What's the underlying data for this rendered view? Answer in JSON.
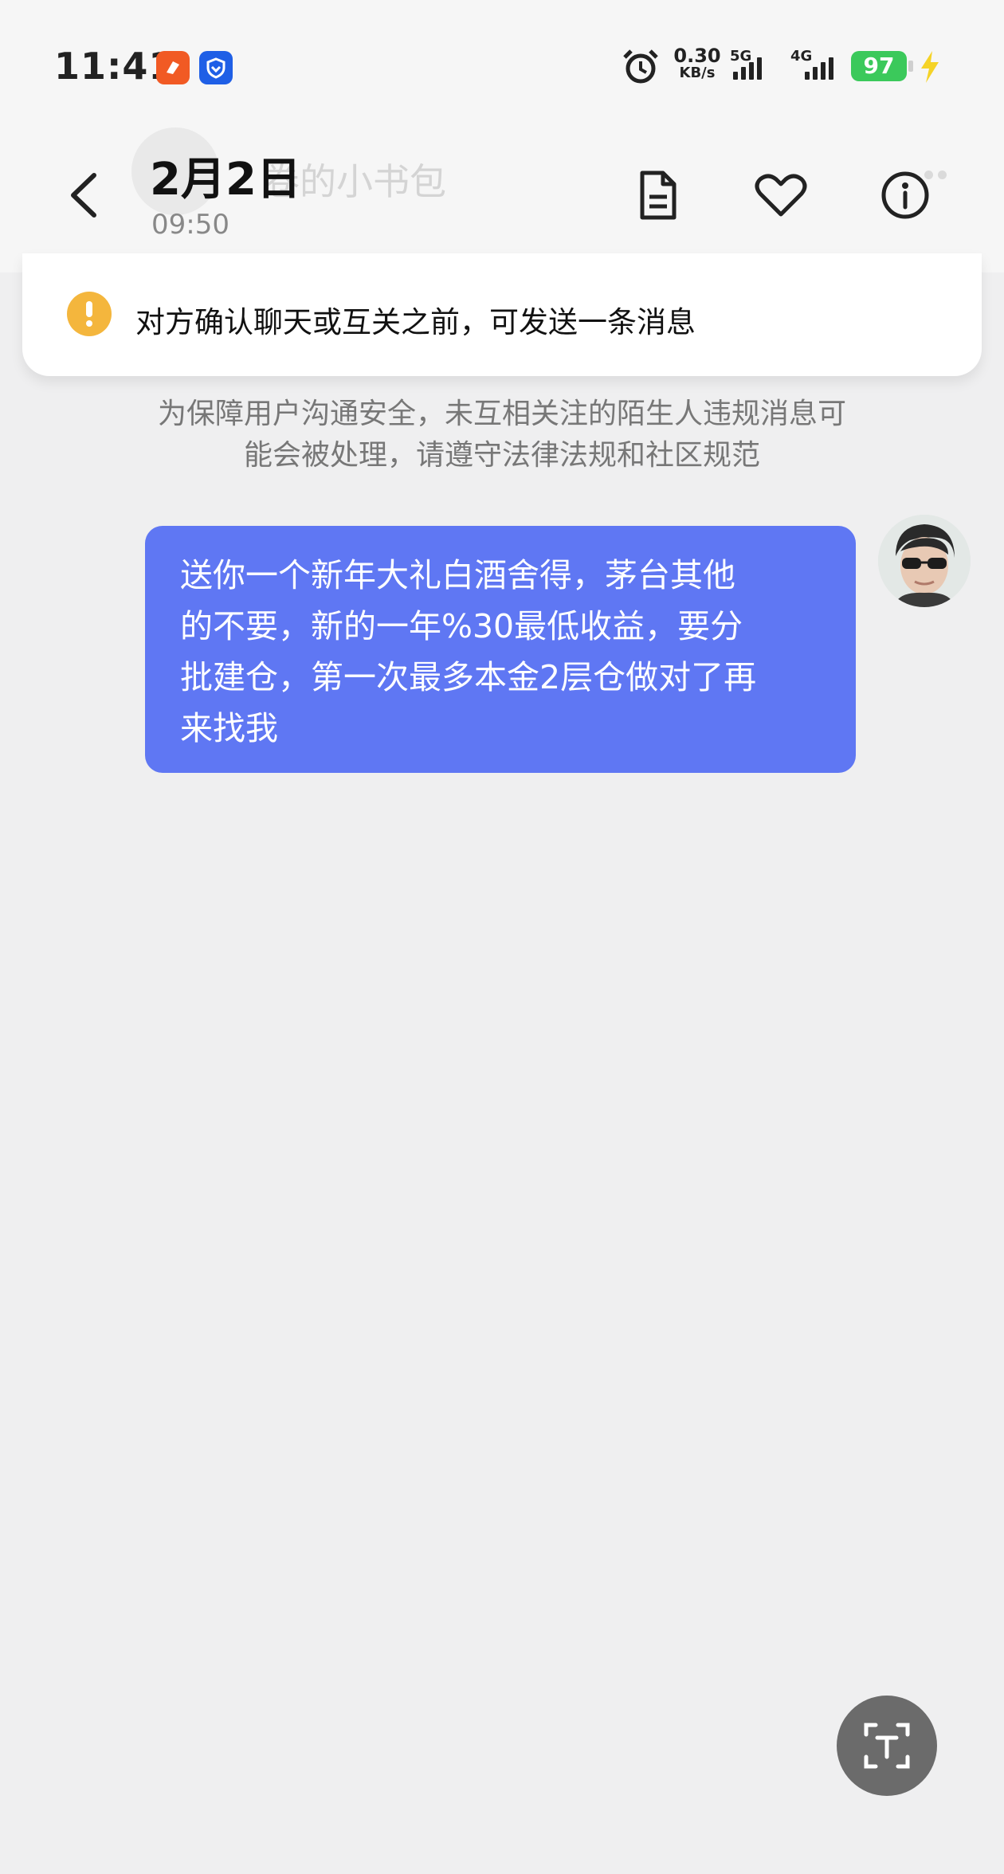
{
  "status_bar": {
    "time": "11:41",
    "net_speed_value": "0.30",
    "net_speed_unit": "KB/s",
    "network_1": "5G",
    "network_2": "4G",
    "battery": "97",
    "icons": [
      "app-notification-icon",
      "security-shield-icon",
      "alarm-icon",
      "signal-icon",
      "battery-icon",
      "charging-bolt-icon"
    ]
  },
  "header": {
    "title": "2月2日",
    "time": "09:50",
    "faded_contact_name": "卷的小书包",
    "icons": [
      "back-arrow-icon",
      "document-icon",
      "heart-icon",
      "info-icon"
    ]
  },
  "notice": {
    "text": "对方确认聊天或互关之前，可发送一条消息",
    "icon": "warning-icon"
  },
  "safety_tip": {
    "line1": "为保障用户沟通安全，未互相关注的陌生人违规消息可",
    "line2": "能会被处理，请遵守法律法规和社区规范"
  },
  "messages": [
    {
      "sender": "self",
      "lines": [
        "送你一个新年大礼白酒舍得，茅台其他",
        "的不要，新的一年%30最低收益，要分",
        "批建仓，第一次最多本金2层仓做对了再",
        "来找我"
      ]
    }
  ],
  "fab": {
    "icon": "text-scan-icon"
  },
  "colors": {
    "bubble": "#5f77f3",
    "warning": "#f4b63d",
    "battery": "#3bc95b",
    "background": "#efeff0"
  }
}
